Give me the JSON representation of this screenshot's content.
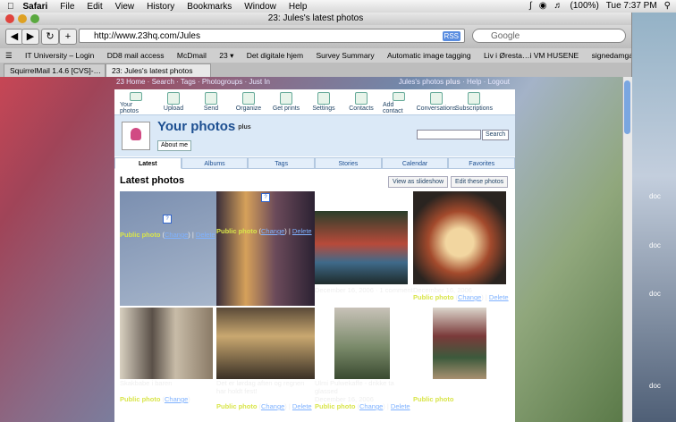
{
  "menubar": {
    "app": "Safari",
    "items": [
      "File",
      "Edit",
      "View",
      "History",
      "Bookmarks",
      "Window",
      "Help"
    ],
    "battery": "(100%)",
    "clock": "Tue 7:37 PM"
  },
  "window": {
    "title": "23: Jules's latest photos",
    "url": "http://www.23hq.com/Jules",
    "rss": "RSS",
    "search_placeholder": "Google"
  },
  "bookmarks": [
    "IT University – Login",
    "DD8 mail access",
    "McDmail",
    "23 ▾",
    "Det digitale hjem",
    "Survey Summary",
    "Automatic image tagging",
    "Liv i Øresta…i VM HUSENE",
    "signedamgaard"
  ],
  "tabs": [
    "SquirrelMail 1.4.6 [CVS]-…",
    "23: Jules's latest photos"
  ],
  "site": {
    "topnav_left": "23 Home · Search · Tags · Photogroups · Just In",
    "topnav_right_link": "Jules's photos",
    "topnav_right_plus": "plus",
    "topnav_right_rest": "· Help · Logout",
    "icons": [
      "Your photos",
      "Upload",
      "Send",
      "Organize",
      "Get prints",
      "Settings",
      "Contacts",
      "Add contact",
      "Conversations",
      "Subscriptions"
    ],
    "title": "Your photos",
    "title_plus": "plus",
    "about": "About me",
    "search_button": "Search",
    "nav": [
      "Latest",
      "Albums",
      "Tags",
      "Stories",
      "Calendar",
      "Favorites"
    ],
    "section_title": "Latest photos",
    "slideshow": "View as slideshow",
    "edit": "Edit these photos"
  },
  "photo_captions": {
    "c1_pub": "Public photo",
    "c1_change": "Change",
    "c1_delete": "Delete",
    "c2_pub": "Public photo",
    "c2_change": "Change",
    "c2_delete": "Delete",
    "c3_date": "December 16, 2006",
    "c3_comment": "1 comment",
    "c4_date": "December 16, 2006",
    "c4_pub": "Public photo",
    "c4_change": "Change",
    "c4_delete": "Delete",
    "c5_title": "Skakbabe i baren",
    "c6_title": "Det er lørdag aften og regnen har holdt fest!",
    "c7_title": "Ulmi Pulwekaffe - drikke ta glassed",
    "c5_pub": "Public photo",
    "c5_change": "Change",
    "c6_pub": "Public photo",
    "c6_change": "Change",
    "c6_delete": "Delete",
    "c7_date": "December 16, 2006",
    "c7_pub": "Public photo",
    "c7_change": "Change",
    "c7_delete": "Delete",
    "c8_pub": "Public photo"
  },
  "desktop_labels": [
    "doc",
    "doc",
    "doc",
    "doc"
  ]
}
